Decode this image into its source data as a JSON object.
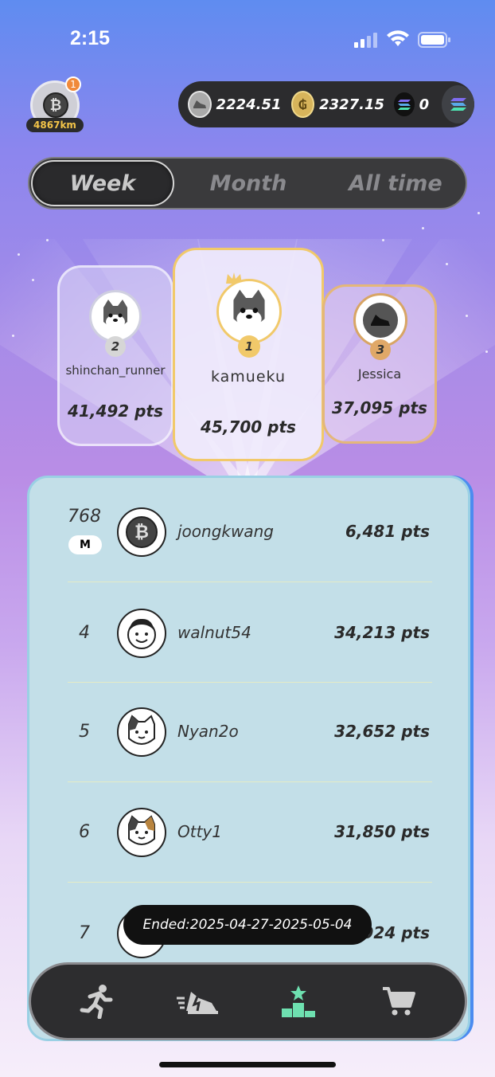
{
  "status_bar": {
    "time": "2:15"
  },
  "profile": {
    "badge_count": "1",
    "distance": "4867km",
    "coin_glyph": "₿"
  },
  "wallet": {
    "items": [
      {
        "icon": "sneaker-coin-icon",
        "value": "2224.51"
      },
      {
        "icon": "gst-coin-icon",
        "value": "2327.15"
      },
      {
        "icon": "solana-icon",
        "value": "0"
      }
    ]
  },
  "tabs": {
    "week": "Week",
    "month": "Month",
    "all_time": "All time",
    "active": "Week"
  },
  "podium": {
    "first": {
      "rank": "1",
      "name": "kamueku",
      "points": "45,700 pts"
    },
    "second": {
      "rank": "2",
      "name": "shinchan_runner",
      "points": "41,492 pts"
    },
    "third": {
      "rank": "3",
      "name": "Jessica",
      "points": "37,095 pts"
    }
  },
  "leaderboard": {
    "me": {
      "rank": "768",
      "badge": "M",
      "name": "joongkwang",
      "points": "6,481 pts"
    },
    "rows": [
      {
        "rank": "4",
        "name": "walnut54",
        "points": "34,213 pts"
      },
      {
        "rank": "5",
        "name": "Nyan2o",
        "points": "32,652 pts"
      },
      {
        "rank": "6",
        "name": "Otty1",
        "points": "31,850 pts"
      },
      {
        "rank": "7",
        "name": "",
        "points": "924 pts"
      }
    ]
  },
  "toast": {
    "text": "Ended:2025-04-27-2025-05-04"
  },
  "nav": {
    "items": [
      "run-icon",
      "sneaker-icon",
      "leaderboard-icon",
      "cart-icon"
    ],
    "active": "leaderboard-icon"
  },
  "colors": {
    "gold": "#f1c96a",
    "accent_green": "#6ee0b0",
    "list_bg": "#c3dfe8"
  }
}
